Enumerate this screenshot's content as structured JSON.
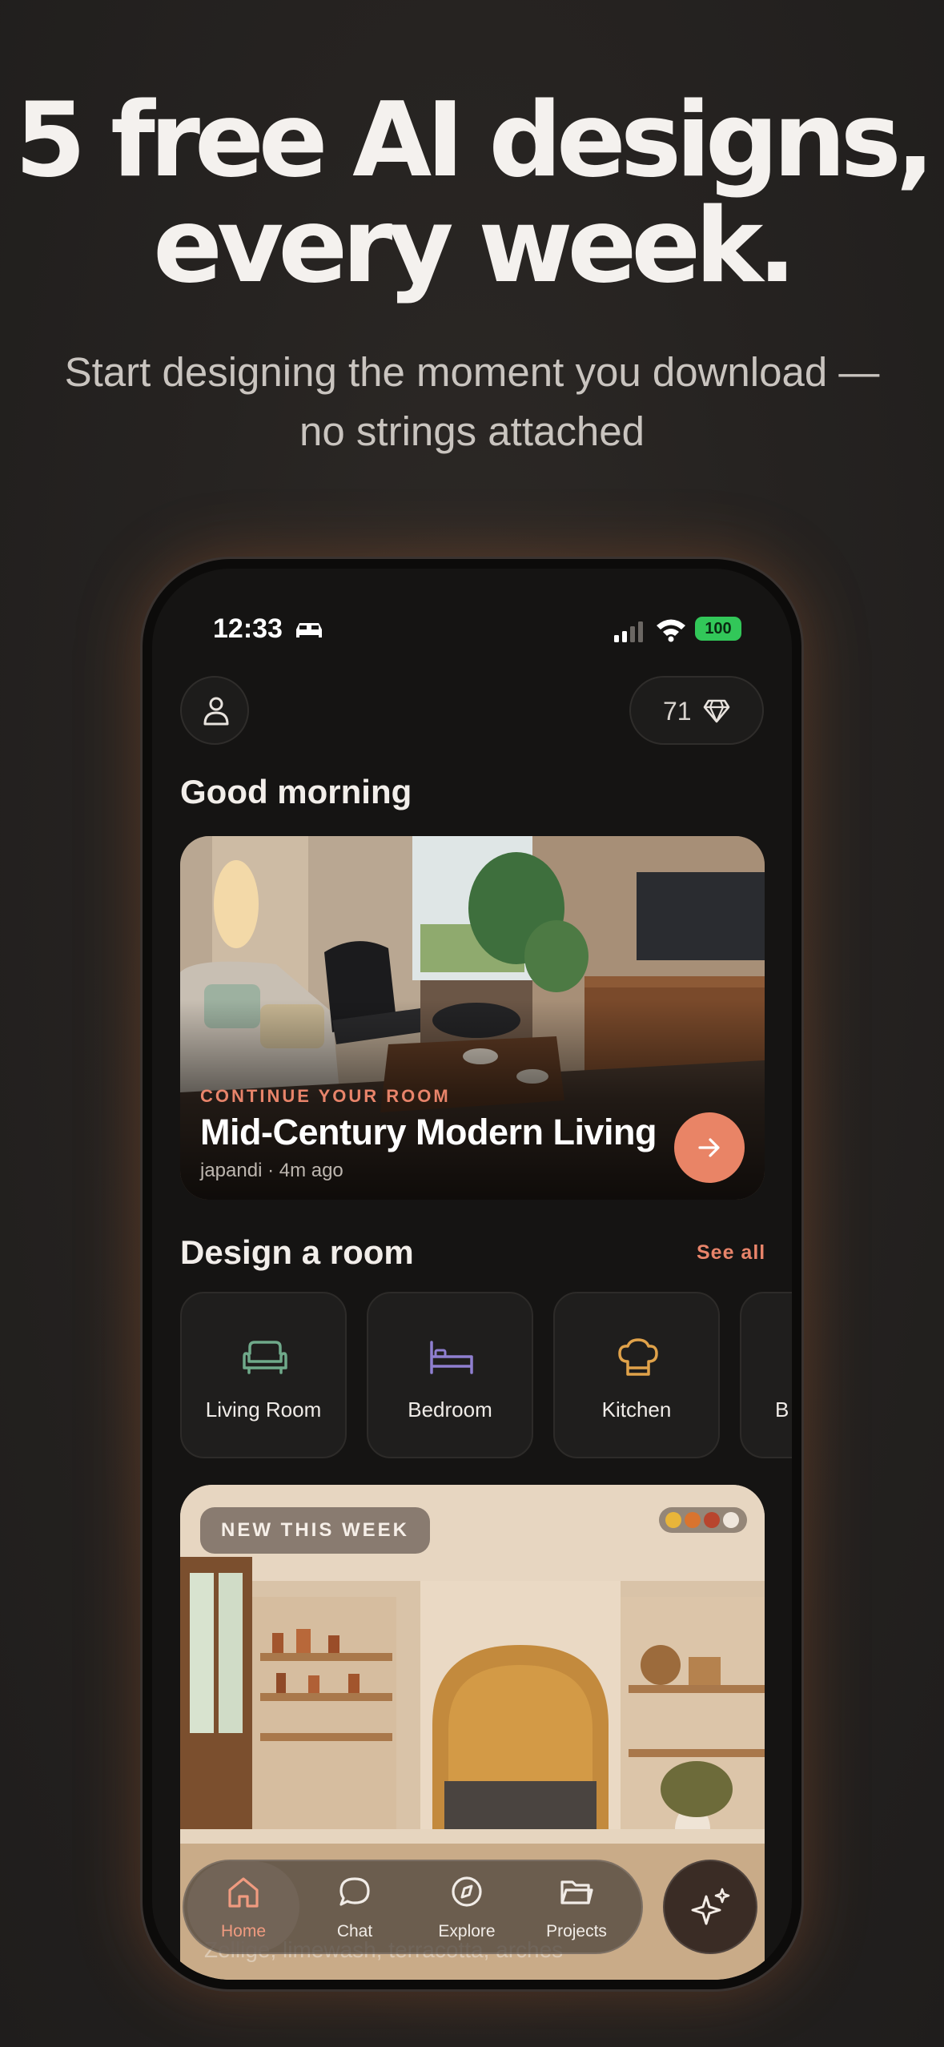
{
  "promo": {
    "headline_line1": "5 free AI designs,",
    "headline_line2": "every week.",
    "subhead_line1": "Start designing the moment you download —",
    "subhead_line2": "no strings attached"
  },
  "status_bar": {
    "time": "12:33",
    "battery": "100",
    "icons": [
      "car-icon",
      "signal-icon",
      "wifi-icon",
      "battery-icon"
    ]
  },
  "header": {
    "profile_icon": "person-icon",
    "credits": "71",
    "credits_icon": "diamond-icon"
  },
  "greeting": "Good morning",
  "continue_card": {
    "eyebrow": "CONTINUE YOUR ROOM",
    "title": "Mid-Century Modern Living",
    "meta": "japandi · 4m ago",
    "action_icon": "arrow-right-icon"
  },
  "design_section": {
    "title": "Design a room",
    "see_all": "See all",
    "rooms": [
      {
        "label": "Living Room",
        "icon": "sofa-icon",
        "color": "#6fa98a"
      },
      {
        "label": "Bedroom",
        "icon": "bed-icon",
        "color": "#8f7fd0"
      },
      {
        "label": "Kitchen",
        "icon": "chef-hat-icon",
        "color": "#e0a24a"
      },
      {
        "label": "B",
        "icon": "bath-icon",
        "color": "#7aa0c8"
      }
    ]
  },
  "week_card": {
    "badge": "NEW THIS WEEK",
    "palette": [
      "#e8b53a",
      "#d9742f",
      "#b8452e",
      "#efe6dc"
    ],
    "subtitle": "Zellige, limewash, terracotta, arches"
  },
  "tab_bar": {
    "tabs": [
      {
        "label": "Home",
        "icon": "home-icon",
        "active": true
      },
      {
        "label": "Chat",
        "icon": "chat-icon",
        "active": false
      },
      {
        "label": "Explore",
        "icon": "compass-icon",
        "active": false
      },
      {
        "label": "Projects",
        "icon": "folder-icon",
        "active": false
      }
    ],
    "fab_icon": "sparkles-icon"
  },
  "colors": {
    "accent": "#e8846a",
    "background": "#151413"
  }
}
